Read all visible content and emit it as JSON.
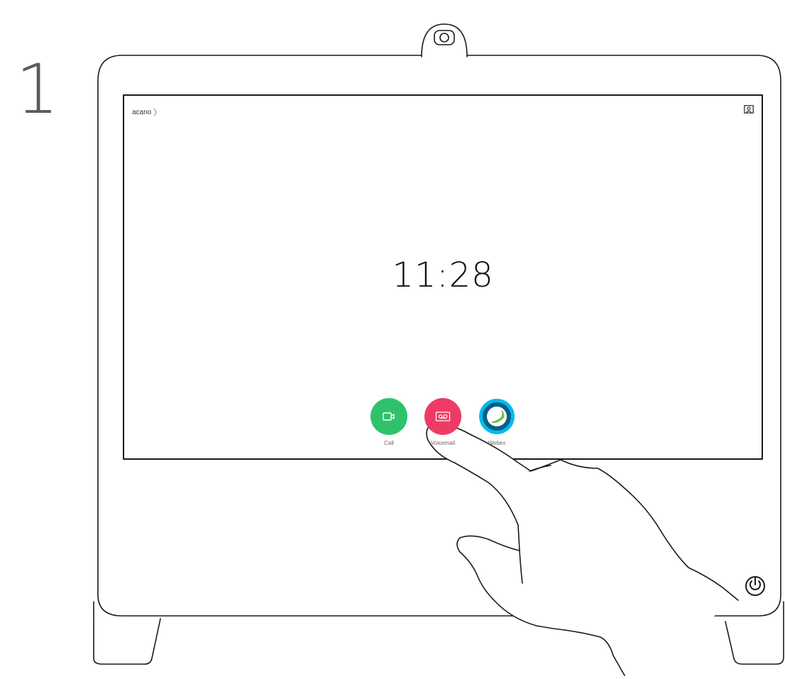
{
  "step": {
    "number": "1"
  },
  "screen": {
    "breadcrumb": {
      "label": "acano",
      "chevron": "〉"
    },
    "clock": "11:28",
    "buttons": [
      {
        "label": "Call",
        "icon": "video-camera-icon",
        "color": "#2ec36b"
      },
      {
        "label": "Voicemail",
        "icon": "voicemail-icon",
        "color": "#ee3b66"
      },
      {
        "label": "Webex",
        "icon": "webex-logo-icon",
        "color": "#00bceb"
      }
    ],
    "selfview_icon": "selfview-icon"
  },
  "device": {
    "camera_icon": "camera-icon",
    "power_icon": "power-icon"
  }
}
